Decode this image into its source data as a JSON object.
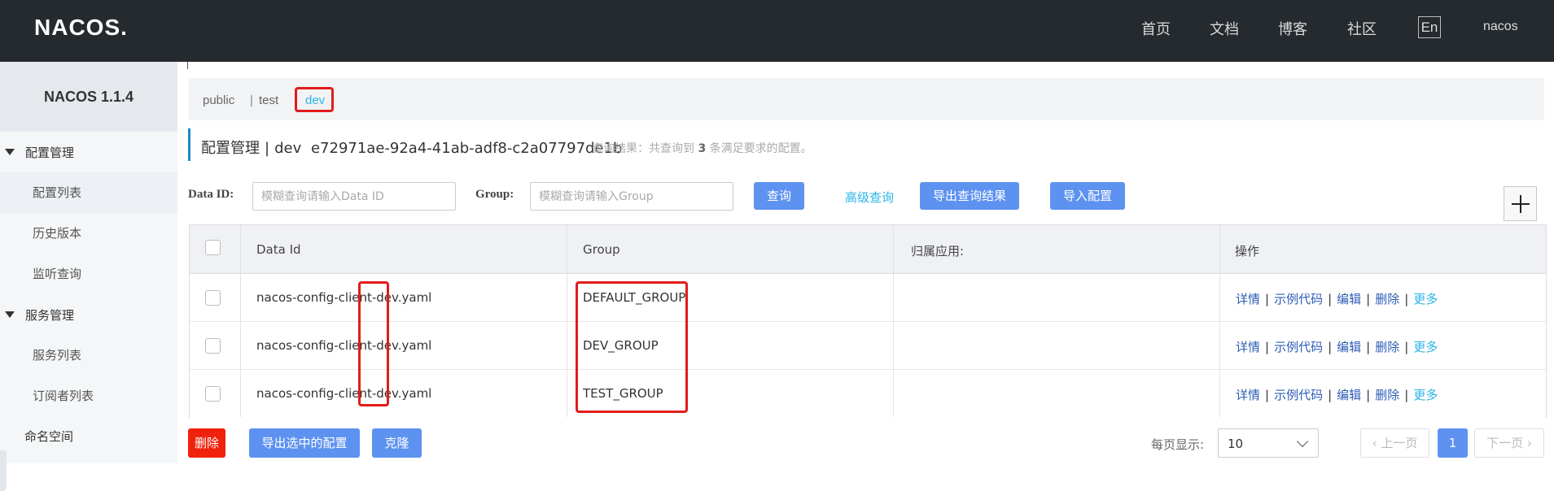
{
  "header": {
    "logo": "NACOS.",
    "nav": [
      "首页",
      "文档",
      "博客",
      "社区"
    ],
    "lang": "En",
    "user": "nacos"
  },
  "sidebar": {
    "title": "NACOS 1.1.4",
    "groups": [
      {
        "label": "配置管理",
        "items": [
          "配置列表",
          "历史版本",
          "监听查询"
        ]
      },
      {
        "label": "服务管理",
        "items": [
          "服务列表",
          "订阅者列表"
        ]
      }
    ],
    "namespace": "命名空间"
  },
  "namespaces": [
    "public",
    "test",
    "dev"
  ],
  "namespace_separator": "|",
  "page": {
    "title": "配置管理",
    "separator": "|",
    "namespace_name": "dev",
    "namespace_id": "e72971ae-92a4-41ab-adf8-c2a07797de1b",
    "result_prefix": "查询结果：共查询到",
    "result_count": "3",
    "result_suffix": "条满足要求的配置。"
  },
  "search": {
    "dataid_label": "Data ID:",
    "dataid_placeholder": "模糊查询请输入Data ID",
    "group_label": "Group:",
    "group_placeholder": "模糊查询请输入Group",
    "query_btn": "查询",
    "advanced": "高级查询",
    "export_result_btn": "导出查询结果",
    "import_btn": "导入配置"
  },
  "table": {
    "headers": [
      "Data Id",
      "Group",
      "归属应用:",
      "操作"
    ],
    "rows": [
      {
        "data_id": "nacos-config-client-dev.yaml",
        "group": "DEFAULT_GROUP",
        "app": ""
      },
      {
        "data_id": "nacos-config-client-dev.yaml",
        "group": "DEV_GROUP",
        "app": ""
      },
      {
        "data_id": "nacos-config-client-dev.yaml",
        "group": "TEST_GROUP",
        "app": ""
      }
    ],
    "ops": [
      "详情",
      "示例代码",
      "编辑",
      "删除",
      "更多"
    ],
    "op_separator": "|"
  },
  "footer": {
    "delete_btn": "删除",
    "export_selected_btn": "导出选中的配置",
    "clone_btn": "克隆",
    "page_size_label": "每页显示:",
    "page_size": "10",
    "prev": "上一页",
    "current_page": "1",
    "next": "下一页"
  },
  "colors": {
    "topbar": "#252a2f",
    "primary_button": "#5e92f0",
    "danger_button": "#f0220e",
    "link": "#2bb5e8",
    "highlight_box": "#e21c1c"
  }
}
